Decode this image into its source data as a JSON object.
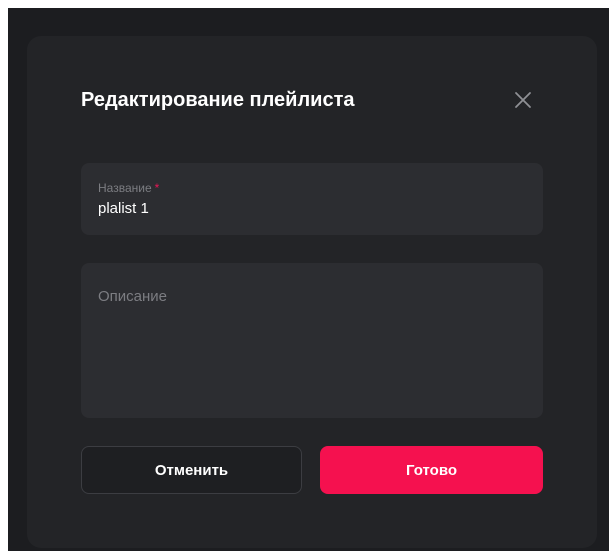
{
  "dialog": {
    "title": "Редактирование плейлиста",
    "close_icon": "close-icon"
  },
  "name_field": {
    "label": "Название",
    "required_mark": "*",
    "value": "plalist 1"
  },
  "description_field": {
    "placeholder": "Описание",
    "value": ""
  },
  "actions": {
    "cancel_label": "Отменить",
    "done_label": "Готово"
  },
  "colors": {
    "accent": "#f5114f",
    "modal_background": "#232427",
    "field_background": "#2c2d31",
    "required_mark": "#ea1556"
  }
}
